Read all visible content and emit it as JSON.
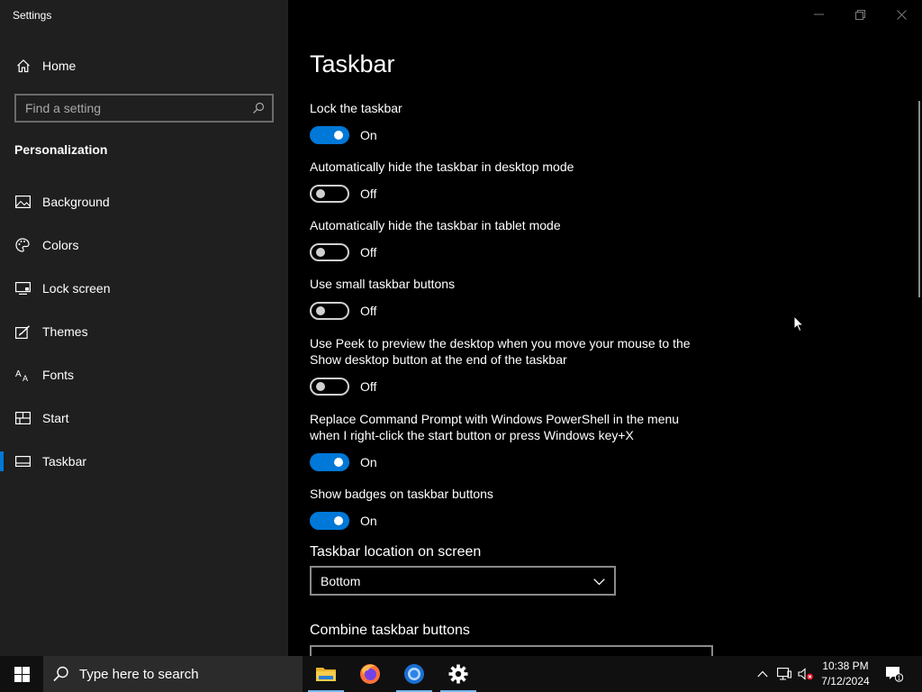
{
  "window": {
    "title": "Settings"
  },
  "sidebar": {
    "home_label": "Home",
    "search_placeholder": "Find a setting",
    "section_title": "Personalization",
    "items": [
      {
        "label": "Background",
        "icon": "picture-icon"
      },
      {
        "label": "Colors",
        "icon": "palette-icon"
      },
      {
        "label": "Lock screen",
        "icon": "lock-screen-icon"
      },
      {
        "label": "Themes",
        "icon": "brush-icon"
      },
      {
        "label": "Fonts",
        "icon": "font-icon"
      },
      {
        "label": "Start",
        "icon": "start-tiles-icon"
      },
      {
        "label": "Taskbar",
        "icon": "taskbar-icon",
        "active": true
      }
    ]
  },
  "main": {
    "title": "Taskbar",
    "settings": [
      {
        "label": "Lock the taskbar",
        "state": "On",
        "on": true
      },
      {
        "label": "Automatically hide the taskbar in desktop mode",
        "state": "Off",
        "on": false
      },
      {
        "label": "Automatically hide the taskbar in tablet mode",
        "state": "Off",
        "on": false
      },
      {
        "label": "Use small taskbar buttons",
        "state": "Off",
        "on": false
      },
      {
        "label": "Use Peek to preview the desktop when you move your mouse to the Show desktop button at the end of the taskbar",
        "state": "Off",
        "on": false
      },
      {
        "label": "Replace Command Prompt with Windows PowerShell in the menu when I right-click the start button or press Windows key+X",
        "state": "On",
        "on": true
      },
      {
        "label": "Show badges on taskbar buttons",
        "state": "On",
        "on": true
      }
    ],
    "location_label": "Taskbar location on screen",
    "location_value": "Bottom",
    "combine_label": "Combine taskbar buttons"
  },
  "taskbar": {
    "search_placeholder": "Type here to search",
    "apps": [
      "file-explorer-icon",
      "firefox-icon",
      "chromium-icon",
      "settings-gear-icon"
    ],
    "time": "10:38 PM",
    "date": "7/12/2024",
    "notification_count": "1"
  },
  "colors": {
    "accent": "#0078d7",
    "sidebar_bg": "#1f1f1f",
    "main_bg": "#000000"
  }
}
